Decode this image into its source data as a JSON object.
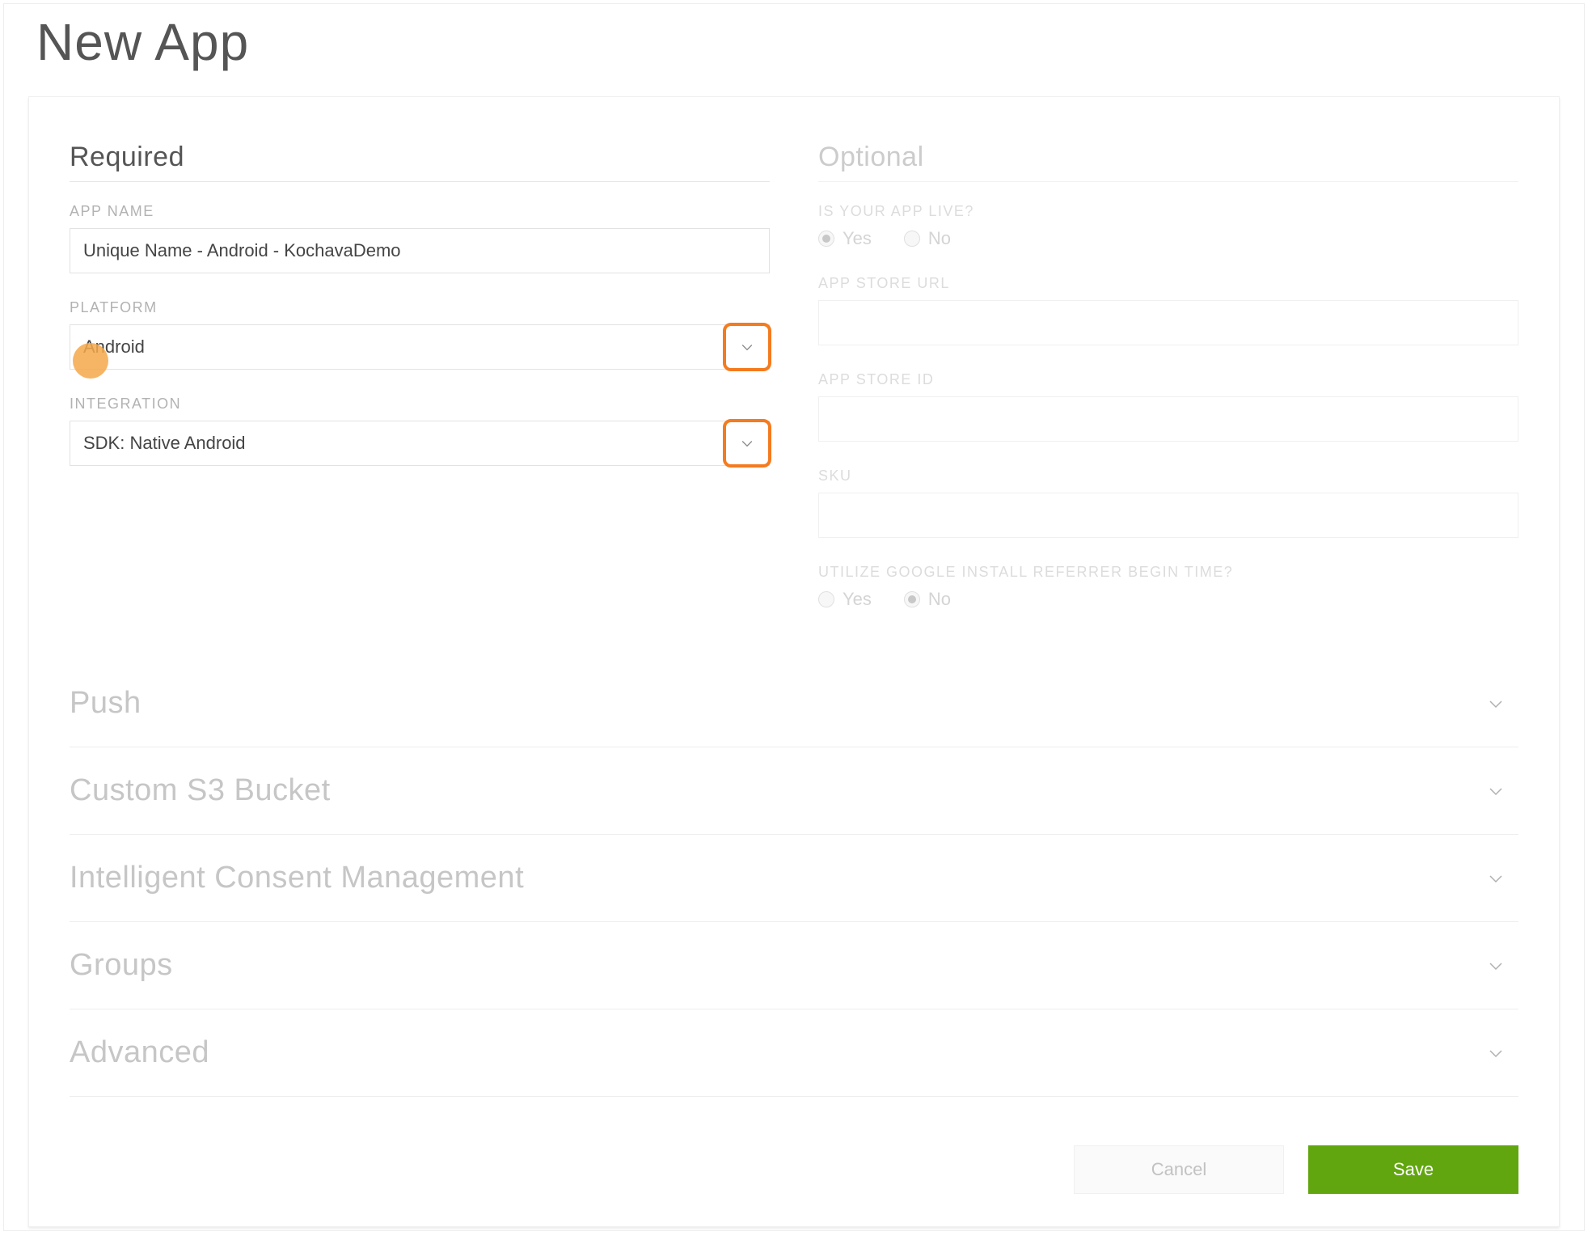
{
  "page_title": "New App",
  "required": {
    "heading": "Required",
    "app_name": {
      "label": "APP NAME",
      "value": "Unique Name - Android - KochavaDemo"
    },
    "platform": {
      "label": "PLATFORM",
      "value": "Android"
    },
    "integration": {
      "label": "INTEGRATION",
      "value": "SDK: Native Android"
    }
  },
  "optional": {
    "heading": "Optional",
    "app_live": {
      "label": "IS YOUR APP LIVE?",
      "yes": "Yes",
      "no": "No",
      "selected": "yes"
    },
    "app_store_url": {
      "label": "APP STORE URL",
      "value": ""
    },
    "app_store_id": {
      "label": "APP STORE ID",
      "value": ""
    },
    "sku": {
      "label": "SKU",
      "value": ""
    },
    "google_referrer": {
      "label": "UTILIZE GOOGLE INSTALL REFERRER BEGIN TIME?",
      "yes": "Yes",
      "no": "No",
      "selected": "no"
    }
  },
  "accordions": [
    {
      "label": "Push"
    },
    {
      "label": "Custom S3 Bucket"
    },
    {
      "label": "Intelligent Consent Management"
    },
    {
      "label": "Groups"
    },
    {
      "label": "Advanced"
    }
  ],
  "buttons": {
    "cancel": "Cancel",
    "save": "Save"
  }
}
